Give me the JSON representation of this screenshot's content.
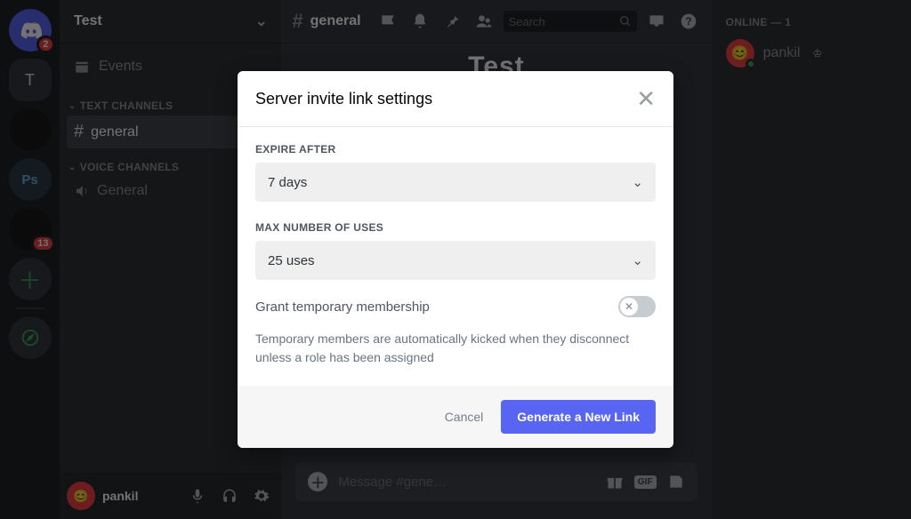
{
  "server_list": {
    "discord_badge": "2",
    "active_initial": "T",
    "ps_label": "Ps",
    "circle_badge": "13"
  },
  "sidebar": {
    "server_name": "Test",
    "events_label": "Events",
    "cat_text": "TEXT CHANNELS",
    "cat_voice": "VOICE CHANNELS",
    "text_channel": "general",
    "voice_channel": "General"
  },
  "user_panel": {
    "name": "pankil"
  },
  "chat": {
    "channel": "general",
    "welcome": "Test",
    "search_placeholder": "Search",
    "input_placeholder": "Message #gene…",
    "gif_label": "GIF"
  },
  "members": {
    "heading": "ONLINE — 1",
    "list": [
      {
        "name": "pankil"
      }
    ]
  },
  "modal": {
    "title": "Server invite link settings",
    "expire_label": "EXPIRE AFTER",
    "expire_value": "7 days",
    "uses_label": "MAX NUMBER OF USES",
    "uses_value": "25 uses",
    "temp_label": "Grant temporary membership",
    "temp_help": "Temporary members are automatically kicked when they disconnect unless a role has been assigned",
    "cancel": "Cancel",
    "generate": "Generate a New Link"
  }
}
